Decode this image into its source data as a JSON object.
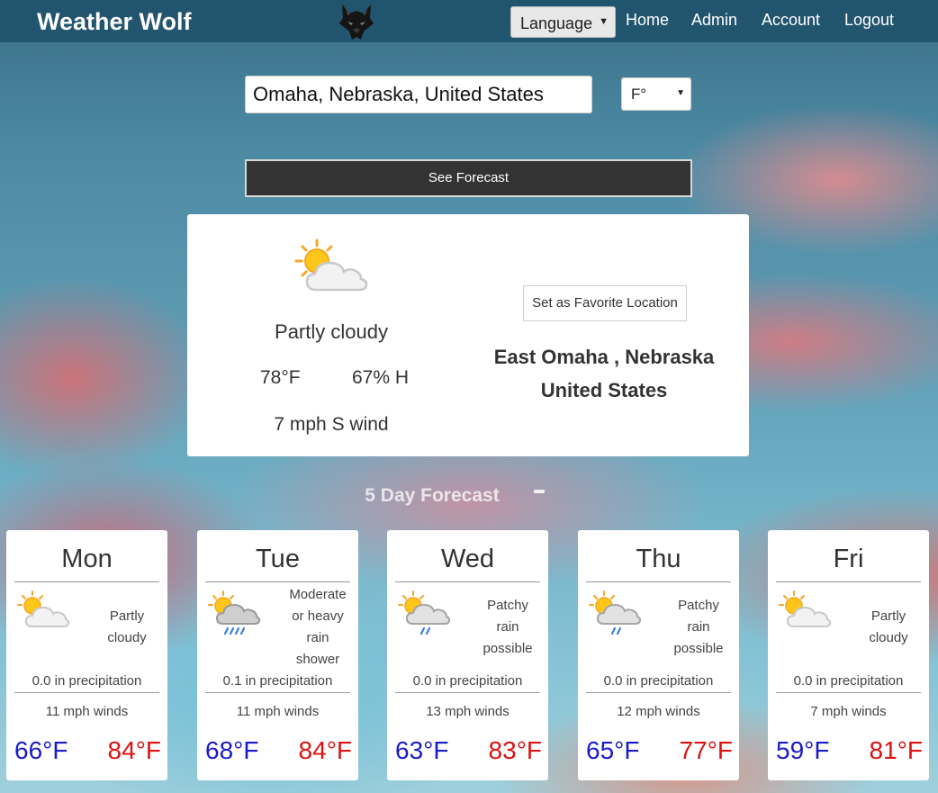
{
  "header": {
    "brand": "Weather Wolf",
    "logo_icon": "wolf-head-icon",
    "language_select": "Language",
    "nav": [
      "Home",
      "Admin",
      "Account",
      "Logout"
    ]
  },
  "search": {
    "location_value": "Omaha, Nebraska, United States",
    "unit_value": "F°",
    "button_label": "See Forecast"
  },
  "current": {
    "icon": "partly-cloudy-icon",
    "condition": "Partly cloudy",
    "temperature": "78°F",
    "humidity": "67% H",
    "wind": "7 mph S wind",
    "favorite_button": "Set as Favorite Location",
    "location_line1": "East Omaha , Nebraska",
    "location_line2": "United States"
  },
  "forecast": {
    "title": "5 Day Forecast",
    "colors": {
      "low": "#1a1acc",
      "high": "#dd1111"
    },
    "days": [
      {
        "day": "Mon",
        "icon": "partly-cloudy-icon",
        "condition": [
          "Partly",
          "cloudy"
        ],
        "precipitation": "0.0 in precipitation",
        "wind": "11 mph winds",
        "low": "66°F",
        "high": "84°F"
      },
      {
        "day": "Tue",
        "icon": "heavy-rain-icon",
        "condition": [
          "Moderate",
          "or heavy",
          "rain",
          "shower"
        ],
        "precipitation": "0.1 in precipitation",
        "wind": "11 mph winds",
        "low": "68°F",
        "high": "84°F"
      },
      {
        "day": "Wed",
        "icon": "patchy-rain-icon",
        "condition": [
          "Patchy",
          "rain",
          "possible"
        ],
        "precipitation": "0.0 in precipitation",
        "wind": "13 mph winds",
        "low": "63°F",
        "high": "83°F"
      },
      {
        "day": "Thu",
        "icon": "patchy-rain-icon",
        "condition": [
          "Patchy",
          "rain",
          "possible"
        ],
        "precipitation": "0.0 in precipitation",
        "wind": "12 mph winds",
        "low": "65°F",
        "high": "77°F"
      },
      {
        "day": "Fri",
        "icon": "partly-cloudy-icon",
        "condition": [
          "Partly",
          "cloudy"
        ],
        "precipitation": "0.0 in precipitation",
        "wind": "7 mph winds",
        "low": "59°F",
        "high": "81°F"
      }
    ]
  }
}
